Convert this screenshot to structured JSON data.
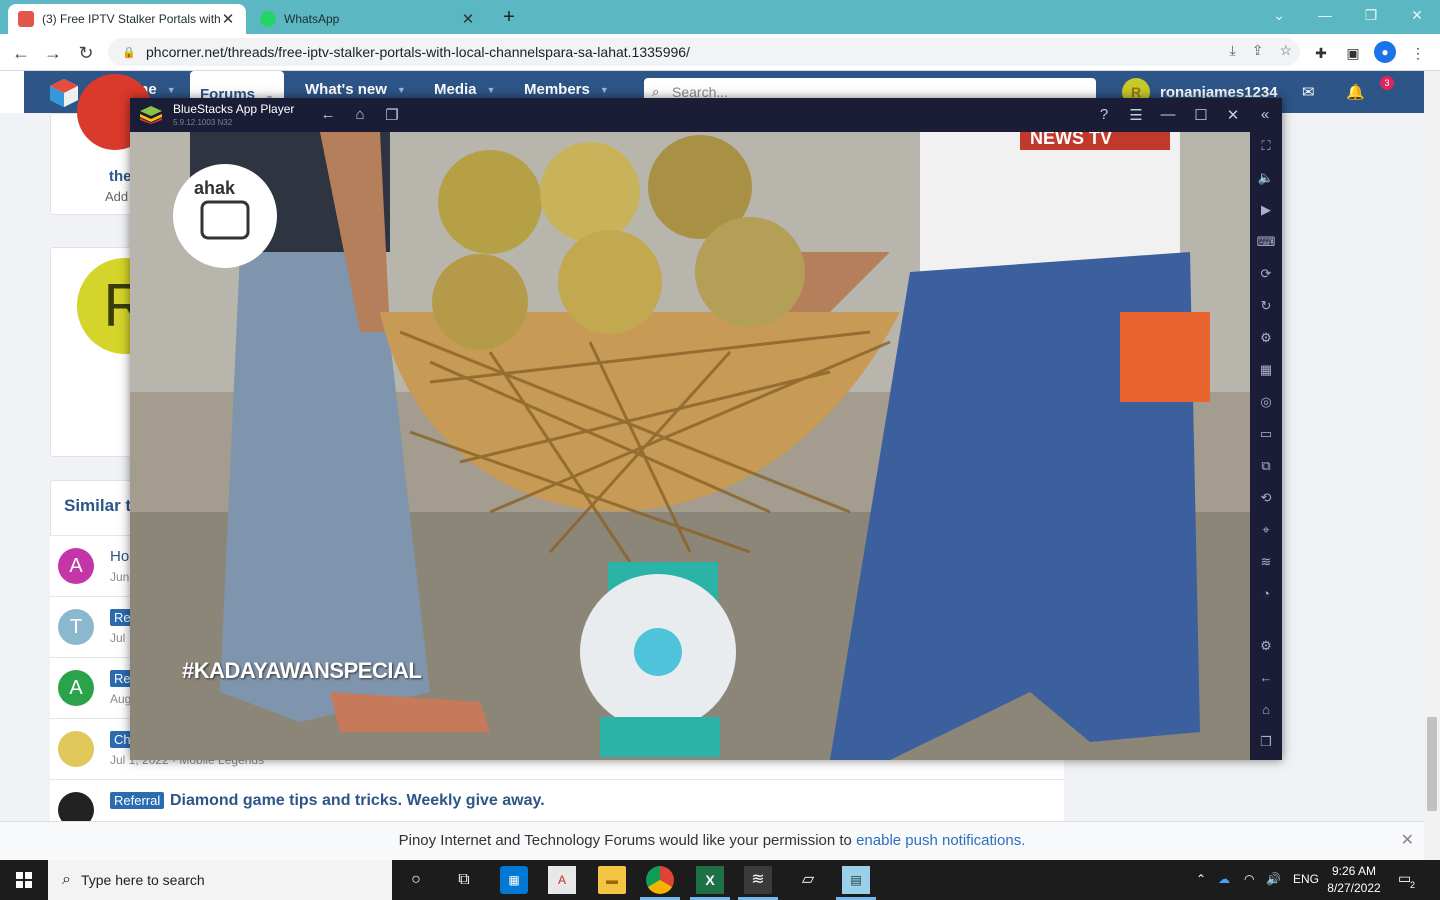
{
  "browser": {
    "tabs": [
      {
        "title": "(3) Free IPTV Stalker Portals with Loc",
        "active": true
      },
      {
        "title": "WhatsApp",
        "active": false
      }
    ],
    "url": "phcorner.net/threads/free-iptv-stalker-portals-with-local-channelspara-sa-lahat.1335996/"
  },
  "forum": {
    "nav": [
      "Home",
      "Forums",
      "What's new",
      "Media",
      "Members"
    ],
    "search_placeholder": "Search...",
    "username": "ronanjames1234",
    "user_initial": "R",
    "alerts_count": "3",
    "card_text_1": "the",
    "card_text_2": "Add",
    "big_avatar_letter": "R",
    "similar_heading": "Similar t",
    "rows": [
      {
        "avatar": "A",
        "avatar_color": "#c435a8",
        "tag": "",
        "title_prefix": "Ho",
        "sub": "Jun"
      },
      {
        "avatar": "T",
        "avatar_color": "#8ab8cf",
        "tag": "Re",
        "title_prefix": "",
        "sub": "Jul"
      },
      {
        "avatar": "A",
        "avatar_color": "#2aa34a",
        "tag": "Re",
        "title_prefix": "",
        "sub": "Aug"
      },
      {
        "avatar": "",
        "avatar_color": "#e0c75a",
        "tag": "Ch",
        "title_prefix": "",
        "sub": "Jul 1, 2022 · Mobile Legends"
      },
      {
        "avatar": "",
        "avatar_color": "#222222",
        "tag": "Referral",
        "title_prefix": "Diamond game tips and tricks. Weekly give away.",
        "sub": "Jul 20, 2022 · Farming, Gambling, Referral"
      }
    ]
  },
  "push": {
    "text": "Pinoy Internet and Technology Forums would like your permission to",
    "link": "enable push notifications."
  },
  "bluestacks": {
    "name": "BlueStacks App Player",
    "version": "5.9.12.1003  N32",
    "hashtag": "#KADAYAWANSPECIAL",
    "channel_logo": "ahak",
    "news_banner": "NEWS TV"
  },
  "taskbar": {
    "search_placeholder": "Type here to search",
    "lang": "ENG",
    "time": "9:26 AM",
    "date": "8/27/2022",
    "notifications": "2"
  },
  "colors": {
    "tabstrip": "#5bb7c1",
    "forum_bar": "#2d5587",
    "bluestacks_chrome": "#1b1d36",
    "taskbar": "#1c1c1c"
  }
}
